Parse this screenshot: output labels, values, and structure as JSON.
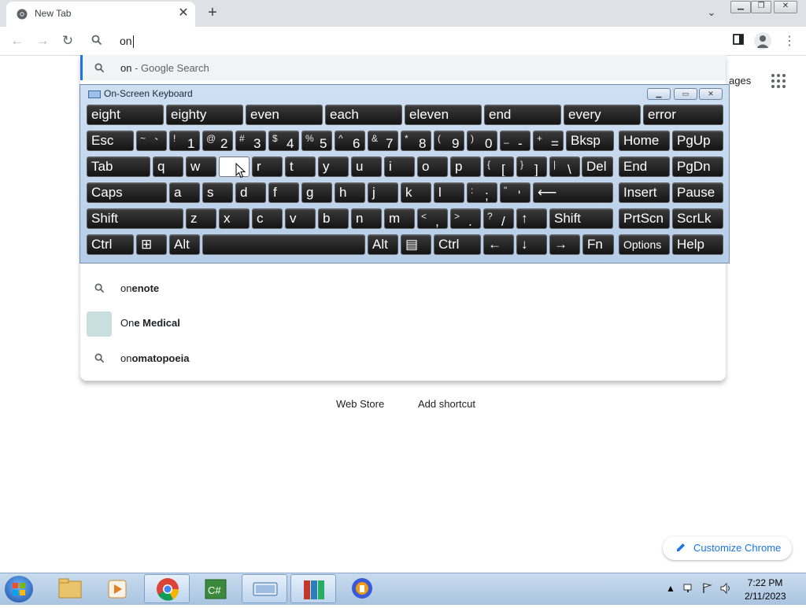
{
  "browser": {
    "tab_title": "New Tab",
    "omnibox_value": "on",
    "images_link": "ages",
    "shortcuts": [
      "Web Store",
      "Add shortcut"
    ],
    "customize_label": "Customize Chrome"
  },
  "dropdown": {
    "first": {
      "prefix": "on",
      "sub": " - Google Search"
    },
    "items": [
      {
        "typed": "on",
        "rest": "enote",
        "kind": "search"
      },
      {
        "typed": "On",
        "rest": "e Medical",
        "kind": "site"
      },
      {
        "typed": "on",
        "rest": "omatopoeia",
        "kind": "search"
      }
    ]
  },
  "osk": {
    "title": "On-Screen Keyboard",
    "predictions": [
      "eight",
      "eighty",
      "even",
      "each",
      "eleven",
      "end",
      "every",
      "error"
    ],
    "row1": [
      {
        "label": "Esc"
      },
      {
        "sup": "~",
        "main": "`"
      },
      {
        "sup": "!",
        "main": "1"
      },
      {
        "sup": "@",
        "main": "2"
      },
      {
        "sup": "#",
        "main": "3"
      },
      {
        "sup": "$",
        "main": "4"
      },
      {
        "sup": "%",
        "main": "5"
      },
      {
        "sup": "^",
        "main": "6"
      },
      {
        "sup": "&",
        "main": "7"
      },
      {
        "sup": "*",
        "main": "8"
      },
      {
        "sup": "(",
        "main": "9"
      },
      {
        "sup": ")",
        "main": "0"
      },
      {
        "sup": "_",
        "main": "-"
      },
      {
        "sup": "+",
        "main": "="
      },
      {
        "label": "Bksp"
      },
      {
        "label": "Home"
      },
      {
        "label": "PgUp"
      }
    ],
    "row2": [
      {
        "label": "Tab"
      },
      {
        "label": "q"
      },
      {
        "label": "w"
      },
      {
        "label": ""
      },
      {
        "label": "r"
      },
      {
        "label": "t"
      },
      {
        "label": "y"
      },
      {
        "label": "u"
      },
      {
        "label": "i"
      },
      {
        "label": "o"
      },
      {
        "label": "p"
      },
      {
        "sup": "{",
        "main": "["
      },
      {
        "sup": "}",
        "main": "]"
      },
      {
        "sup": "|",
        "main": "\\"
      },
      {
        "label": "Del"
      },
      {
        "label": "End"
      },
      {
        "label": "PgDn"
      }
    ],
    "row3": [
      {
        "label": "Caps"
      },
      {
        "label": "a"
      },
      {
        "label": "s"
      },
      {
        "label": "d"
      },
      {
        "label": "f"
      },
      {
        "label": "g"
      },
      {
        "label": "h"
      },
      {
        "label": "j"
      },
      {
        "label": "k"
      },
      {
        "label": "l"
      },
      {
        "sup": ":",
        "main": ";"
      },
      {
        "sup": "\"",
        "main": "'"
      },
      {
        "label": "⟵"
      },
      {
        "label": "Insert"
      },
      {
        "label": "Pause"
      }
    ],
    "row4": [
      {
        "label": "Shift"
      },
      {
        "label": "z"
      },
      {
        "label": "x"
      },
      {
        "label": "c"
      },
      {
        "label": "v"
      },
      {
        "label": "b"
      },
      {
        "label": "n"
      },
      {
        "label": "m"
      },
      {
        "sup": "<",
        "main": ","
      },
      {
        "sup": ">",
        "main": "."
      },
      {
        "sup": "?",
        "main": "/"
      },
      {
        "label": "↑"
      },
      {
        "label": "Shift"
      },
      {
        "label": "PrtScn"
      },
      {
        "label": "ScrLk"
      }
    ],
    "row5": [
      {
        "label": "Ctrl"
      },
      {
        "label": "⊞"
      },
      {
        "label": "Alt"
      },
      {
        "label": ""
      },
      {
        "label": "Alt"
      },
      {
        "label": "▤"
      },
      {
        "label": "Ctrl"
      },
      {
        "label": "←"
      },
      {
        "label": "↓"
      },
      {
        "label": "→"
      },
      {
        "label": "Fn"
      },
      {
        "label": "Options"
      },
      {
        "label": "Help"
      }
    ]
  },
  "taskbar": {
    "time": "7:22 PM",
    "date": "2/11/2023"
  }
}
